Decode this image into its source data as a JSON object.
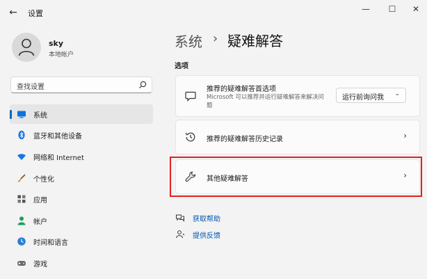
{
  "window": {
    "title": "设置",
    "back_glyph": "←",
    "minimize_glyph": "—",
    "maximize_glyph": "☐",
    "close_glyph": "✕"
  },
  "profile": {
    "name": "sky",
    "account_type": "本地帐户"
  },
  "search": {
    "placeholder": "查找设置",
    "icon": "search-icon"
  },
  "sidebar": {
    "accent_color": "#0067c0",
    "items": [
      {
        "label": "系统",
        "icon": "monitor-icon",
        "selected": true
      },
      {
        "label": "蓝牙和其他设备",
        "icon": "bluetooth-icon"
      },
      {
        "label": "网络和 Internet",
        "icon": "wifi-icon"
      },
      {
        "label": "个性化",
        "icon": "brush-icon"
      },
      {
        "label": "应用",
        "icon": "apps-icon"
      },
      {
        "label": "帐户",
        "icon": "person-icon"
      },
      {
        "label": "时间和语言",
        "icon": "globe-clock-icon"
      },
      {
        "label": "游戏",
        "icon": "gamepad-icon"
      }
    ]
  },
  "main": {
    "breadcrumb": {
      "parent": "系统",
      "separator": "›",
      "current": "疑难解答"
    },
    "section_label": "选项",
    "cards": {
      "preferences": {
        "title": "推荐的疑难解答首选项",
        "subtitle": "Microsoft 可以推荐并运行疑难解答来解决问题",
        "dropdown_value": "运行前询问我",
        "dropdown_chevron": "⌄",
        "icon": "chat-icon"
      },
      "history": {
        "title": "推荐的疑难解答历史记录",
        "icon": "history-icon",
        "chevron": "›"
      },
      "other": {
        "title": "其他疑难解答",
        "icon": "wrench-icon",
        "chevron": "›"
      }
    },
    "links": [
      {
        "label": "获取帮助",
        "icon": "help-icon"
      },
      {
        "label": "提供反馈",
        "icon": "feedback-icon"
      }
    ],
    "highlight_color": "#e02020"
  }
}
